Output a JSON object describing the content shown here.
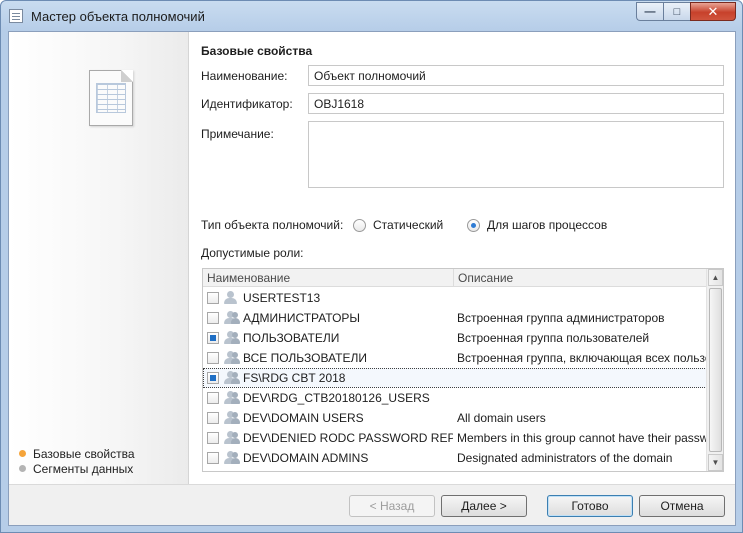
{
  "window": {
    "title": "Мастер объекта полномочий",
    "minimize_glyph": "—",
    "maximize_glyph": "□",
    "close_glyph": "✕"
  },
  "sidebar": {
    "steps": [
      {
        "label": "Базовые свойства",
        "active": true
      },
      {
        "label": "Сегменты данных",
        "active": false
      }
    ]
  },
  "form": {
    "section_title": "Базовые свойства",
    "name_label": "Наименование:",
    "name_value": "Объект полномочий",
    "id_label": "Идентификатор:",
    "id_value": "OBJ1618",
    "note_label": "Примечание:",
    "note_value": "",
    "type_label": "Тип объекта полномочий:",
    "type_options": [
      {
        "label": "Статический",
        "checked": false
      },
      {
        "label": "Для шагов процессов",
        "checked": true
      }
    ],
    "roles_label": "Допустимые роли:"
  },
  "roles": {
    "columns": [
      "Наименование",
      "Описание"
    ],
    "rows": [
      {
        "name": "USERTEST13",
        "description": "",
        "checked": false,
        "group": false
      },
      {
        "name": "АДМИНИСТРАТОРЫ",
        "description": "Встроенная группа администраторов",
        "checked": false,
        "group": true
      },
      {
        "name": "ПОЛЬЗОВАТЕЛИ",
        "description": "Встроенная группа пользователей",
        "checked": true,
        "group": true
      },
      {
        "name": "ВСЕ ПОЛЬЗОВАТЕЛИ",
        "description": "Встроенная группа, включающая всех пользова",
        "checked": false,
        "group": true
      },
      {
        "name": "FS\\RDG CBT 2018",
        "description": "",
        "checked": true,
        "group": true,
        "selected": true
      },
      {
        "name": "DEV\\RDG_CTB20180126_USERS",
        "description": "",
        "checked": false,
        "group": true
      },
      {
        "name": "DEV\\DOMAIN USERS",
        "description": "All domain users",
        "checked": false,
        "group": true
      },
      {
        "name": "DEV\\DENIED RODC PASSWORD REPLICATIC",
        "description": "Members in this group cannot have their passwords",
        "checked": false,
        "group": true
      },
      {
        "name": "DEV\\DOMAIN ADMINS",
        "description": "Designated administrators of the domain",
        "checked": false,
        "group": true
      }
    ]
  },
  "buttons": {
    "back": "< Назад",
    "next": "Далее >",
    "finish": "Готово",
    "cancel": "Отмена"
  },
  "colors": {
    "active_step": "#f5a43a",
    "inactive_step": "#b4b4b4",
    "checkbox_fill": "#1f6fc5",
    "radio_fill": "#2d7bd4"
  }
}
